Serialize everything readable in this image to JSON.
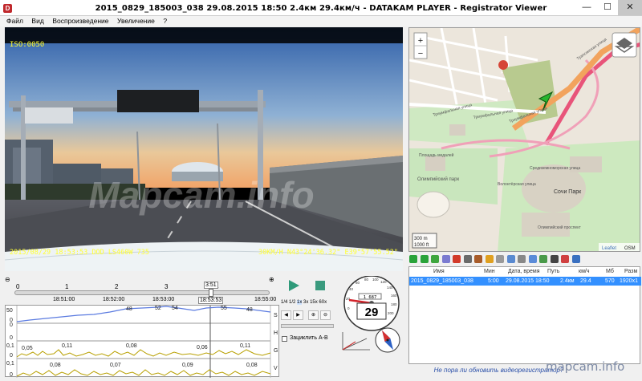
{
  "window": {
    "title": "2015_0829_185003_038    29.08.2015 18:50    2.4км    29.4км/ч  -  DATAKAM PLAYER - Registrator Viewer",
    "minimize": "—",
    "maximize": "☐",
    "close": "✕"
  },
  "menu": [
    "Файл",
    "Вид",
    "Воспроизведение",
    "Увеличение",
    "?"
  ],
  "video": {
    "iso": "ISO:0050",
    "overlay_left": "2015/08/29  18:53:53  DOD LS460W   735",
    "overlay_right": "30KM/H  N43°24'36.32\"  E39°57'55.52\"",
    "watermark": "Mapcam.info"
  },
  "map": {
    "zoom_in": "+",
    "zoom_out": "−",
    "scale_m": "300 m",
    "scale_ft": "1000 ft",
    "attribution_leaflet": "Leaflet",
    "attribution_osm": "OSM",
    "marker_label": "F",
    "labels": {
      "triumph1": "Триумфальная улица",
      "triumph2": "Триумфальная улица",
      "triumph3": "Триумфальная улица",
      "placeholder_square": "Площадь медалей",
      "olympic_park": "Олимпийский парк",
      "sochi_park": "Сочи Парк",
      "volunteer": "Волонтёрская улица",
      "mediterranean": "Средиземноморская улица",
      "olympic_ave": "Олимпийский проспект",
      "tuapse": "Туапсинская улица"
    }
  },
  "filetable": {
    "headers": [
      "Имя",
      "Мин",
      "Дата, время",
      "Путь",
      "км/ч",
      "Мб",
      "Разм"
    ],
    "row": [
      "2015_0829_185003_038",
      "5:00",
      "29.08.2015 18:50",
      "2.4км",
      "29.4",
      "570",
      "1920x1"
    ]
  },
  "update_link": "Не пора ли обновить видеорегистратор?",
  "watermark_corner": "mapcam.info",
  "timeline": {
    "ticks": [
      "0",
      "1",
      "2",
      "3",
      "4"
    ],
    "times": [
      "18:51:00",
      "18:52:00",
      "18:53:00",
      "18:53:53",
      "18:55:00"
    ],
    "cursor_time": "3:51"
  },
  "graphs": {
    "s_values": [
      "48",
      "52",
      "54",
      "55",
      "48"
    ],
    "s_axis": [
      "50",
      "0"
    ],
    "h_axis": [
      "0",
      "0"
    ],
    "g_axis": [
      "0,1",
      "0"
    ],
    "g_values": [
      "0,05",
      "0,11",
      "0,08",
      "0,06",
      "0,11"
    ],
    "v_axis": [
      "0,1",
      "0"
    ],
    "v_values": [
      "0,08",
      "0,07",
      "0,09",
      "0,08"
    ],
    "right_labels": [
      "S",
      "H",
      "G",
      "V"
    ]
  },
  "controls": {
    "speeds": [
      "1/4",
      "1/2",
      "1x",
      "3x",
      "15x",
      "60x"
    ],
    "loop_label": "Зациклить A-B"
  },
  "gauge": {
    "speed": "29",
    "odometer": "1 687",
    "dial_numbers": [
      "0",
      "20",
      "40",
      "60",
      "80",
      "100",
      "120",
      "140",
      "160",
      "180",
      "200"
    ]
  },
  "colors": {
    "accent": "#3390ff",
    "title_close": "#c7c7c7",
    "map_route": "#e8547a",
    "speed_graph": "#5b7be0",
    "g_graph": "#b8a000",
    "osd_text": "#ffff33"
  }
}
